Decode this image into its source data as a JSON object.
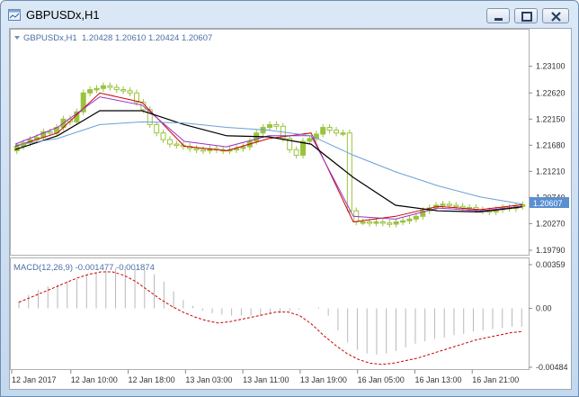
{
  "window": {
    "title": "GBPUSDx,H1"
  },
  "main_panel": {
    "symbol_label": "GBPUSDx,H1",
    "ohlc_label": "1.20428 1.20610 1.20424 1.20607",
    "current_price": "1.20607"
  },
  "macd_panel": {
    "label": "MACD(12,26,9) -0.001477 -0.001874"
  },
  "colors": {
    "bull_candle": "#9ac33e",
    "ma_fast": "#cc0000",
    "ma_mid": "#9933cc",
    "ma_slow": "#000000",
    "ma_long": "#6aa0d8",
    "macd_hist": "#b8b8b8",
    "macd_signal": "#cc0000",
    "price_box": "#5a8fd0",
    "axis_text": "#333333"
  },
  "chart_data": [
    {
      "type": "candlestick",
      "title": "GBPUSDx,H1",
      "ylim": [
        1.1979,
        1.2345
      ],
      "y_ticks": [
        "1.23100",
        "1.22620",
        "1.22150",
        "1.21680",
        "1.21210",
        "1.20740",
        "1.20270",
        "1.19790"
      ],
      "x_ticks": [
        "12 Jan 2017",
        "12 Jan 10:00",
        "12 Jan 18:00",
        "13 Jan 03:00",
        "13 Jan 11:00",
        "13 Jan 19:00",
        "16 Jan 05:00",
        "16 Jan 13:00",
        "16 Jan 21:00"
      ],
      "closes": [
        1.2166,
        1.2172,
        1.2178,
        1.2182,
        1.2192,
        1.219,
        1.22,
        1.2215,
        1.221,
        1.2228,
        1.2262,
        1.2268,
        1.227,
        1.2275,
        1.2272,
        1.2268,
        1.2266,
        1.2262,
        1.2245,
        1.2232,
        1.2205,
        1.219,
        1.2178,
        1.217,
        1.2168,
        1.2166,
        1.2162,
        1.216,
        1.2158,
        1.2162,
        1.216,
        1.2158,
        1.216,
        1.2162,
        1.2165,
        1.2175,
        1.219,
        1.22,
        1.2205,
        1.2202,
        1.218,
        1.216,
        1.215,
        1.2175,
        1.218,
        1.2188,
        1.22,
        1.2195,
        1.219,
        1.219,
        1.205,
        1.203,
        1.203,
        1.2028,
        1.203,
        1.2028,
        1.2026,
        1.203,
        1.2032,
        1.2035,
        1.204,
        1.205,
        1.2055,
        1.206,
        1.2062,
        1.206,
        1.2058,
        1.2055,
        1.2056,
        1.2052,
        1.205,
        1.2048,
        1.2052,
        1.2056,
        1.2054,
        1.2058,
        1.2061
      ],
      "series": [
        {
          "values": [
            1.2166,
            1.219,
            1.2262,
            1.2245,
            1.2166,
            1.2158,
            1.218,
            1.219,
            1.203,
            1.204,
            1.2058,
            1.2052,
            1.2061
          ]
        },
        {
          "values": [
            1.217,
            1.22,
            1.2255,
            1.224,
            1.2175,
            1.2165,
            1.2185,
            1.2185,
            1.204,
            1.2035,
            1.2055,
            1.205,
            1.2058
          ]
        },
        {
          "values": [
            1.216,
            1.2185,
            1.223,
            1.223,
            1.2205,
            1.2185,
            1.2183,
            1.217,
            1.211,
            1.206,
            1.205,
            1.2048,
            1.2057
          ]
        },
        {
          "values": [
            1.2168,
            1.218,
            1.2205,
            1.221,
            1.2208,
            1.22,
            1.2195,
            1.2185,
            1.215,
            1.212,
            1.2095,
            1.2075,
            1.2062
          ]
        }
      ]
    },
    {
      "type": "bar",
      "title": "MACD(12,26,9) -0.001477 -0.001874",
      "ylim": [
        -0.00484,
        0.00359
      ],
      "y_ticks": [
        "0.00359",
        "0.00",
        "-0.00484"
      ],
      "histogram": [
        0.0006,
        0.0011,
        0.0015,
        0.0018,
        0.002,
        0.0022,
        0.0024,
        0.0027,
        0.0029,
        0.0031,
        0.0033,
        0.0035,
        0.0034,
        0.0032,
        0.0028,
        0.0022,
        0.0014,
        0.0007,
        0.0002,
        -0.0002,
        -0.0004,
        -0.0005,
        -0.0006,
        -0.0006,
        -0.0006,
        -0.0006,
        -0.0005,
        -0.0004,
        -0.0002,
        -0.0001,
        0.0,
        0.0001,
        -0.0006,
        -0.0018,
        -0.0028,
        -0.0034,
        -0.0037,
        -0.0038,
        -0.0037,
        -0.0035,
        -0.0032,
        -0.0029,
        -0.0027,
        -0.0025,
        -0.0024,
        -0.0022,
        -0.0021,
        -0.0019,
        -0.0018,
        -0.0017,
        -0.0016,
        -0.0015,
        -0.0015
      ],
      "signal": [
        0.0005,
        0.0009,
        0.0013,
        0.0017,
        0.0021,
        0.0025,
        0.0028,
        0.003,
        0.003,
        0.0027,
        0.0022,
        0.0015,
        0.0008,
        0.0002,
        -0.0003,
        -0.0007,
        -0.001,
        -0.0012,
        -0.0011,
        -0.0009,
        -0.0007,
        -0.0005,
        -0.0003,
        -0.0003,
        -0.0006,
        -0.0013,
        -0.0022,
        -0.003,
        -0.0037,
        -0.0042,
        -0.0045,
        -0.0046,
        -0.0045,
        -0.0043,
        -0.0041,
        -0.0038,
        -0.0035,
        -0.0032,
        -0.0029,
        -0.0026,
        -0.0024,
        -0.0022,
        -0.002,
        -0.0019
      ]
    }
  ]
}
